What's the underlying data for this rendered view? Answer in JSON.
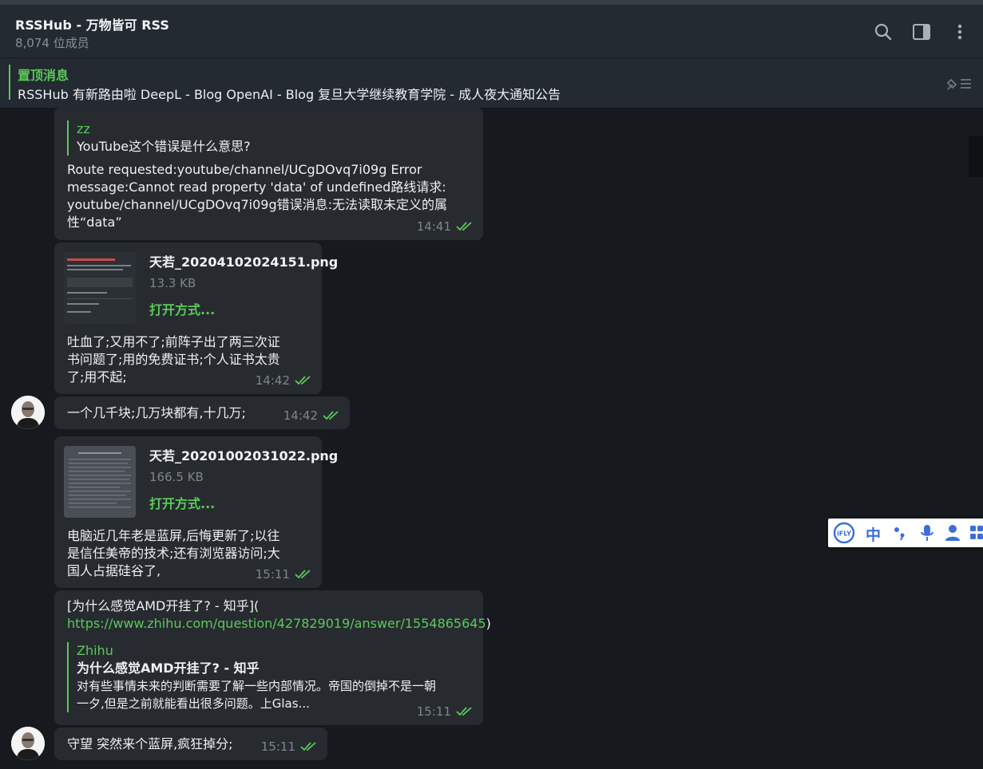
{
  "header": {
    "title": "RSSHub - 万物皆可 RSS",
    "members": "8,074 位成员",
    "icons": [
      "search-icon",
      "sidebar-toggle-icon",
      "more-vert-icon"
    ]
  },
  "pinned": {
    "label": "置顶消息",
    "text": "RSSHub 有新路由啦 DeepL - Blog OpenAI - Blog 复旦大学继续教育学院 - 成人夜大通知公告",
    "icon": "pinned-list-icon"
  },
  "colors": {
    "accent": "#5cc85a",
    "bubble": "#272b30",
    "header": "#232a31",
    "background": "#16191d"
  },
  "messages": [
    {
      "id": "m1",
      "reply_author": "zz",
      "reply_text": "YouTube这个错误是什么意思?",
      "text_lines": [
        "Route requested:youtube/channel/UCgDOvq7i09g Error",
        "message:Cannot read property 'data' of undefined路线请求:",
        "youtube/channel/UCgDOvq7i09g错误消息:无法读取未定义的属",
        "性“data”"
      ],
      "time": "14:41"
    },
    {
      "id": "m2",
      "file_name": "天若_20204102024151.png",
      "file_size": "13.3 KB",
      "open_label": "打开方式...",
      "text_lines": [
        "吐血了;又用不了;前阵子出了两三次证",
        "书问题了;用的免费证书;个人证书太贵",
        "了;用不起;"
      ],
      "time": "14:42"
    },
    {
      "id": "m3",
      "text": "一个几千块;几万块都有,十几万;",
      "time": "14:42"
    },
    {
      "id": "m4",
      "file_name": "天若_20201002031022.png",
      "file_size": "166.5 KB",
      "open_label": "打开方式...",
      "text_lines": [
        "电脑近几年老是蓝屏,后悔更新了;以往",
        "是信任美帝的技术;还有浏览器访问;大",
        "国人占据硅谷了,"
      ],
      "time": "15:11"
    },
    {
      "id": "m5",
      "text_line1": "[为什么感觉AMD开挂了? - 知乎](",
      "link": "https://www.zhihu.com/question/427829019/answer/1554865645",
      "link_suffix": ")",
      "preview_site": "Zhihu",
      "preview_title": "为什么感觉AMD开挂了? - 知乎",
      "preview_lines": [
        "对有些事情未来的判断需要了解一些内部情况。帝国的倒掉不是一朝",
        "一夕,但是之前就能看出很多问题。上Glas..."
      ],
      "time": "15:11"
    },
    {
      "id": "m6",
      "text": "守望 突然来个蓝屏,疯狂掉分;",
      "time": "15:11"
    }
  ],
  "ime_toolbar": {
    "logo": "iFLY",
    "mode": "中",
    "icons": [
      "punctuation-icon",
      "microphone-icon",
      "user-icon",
      "grid-icon"
    ]
  }
}
